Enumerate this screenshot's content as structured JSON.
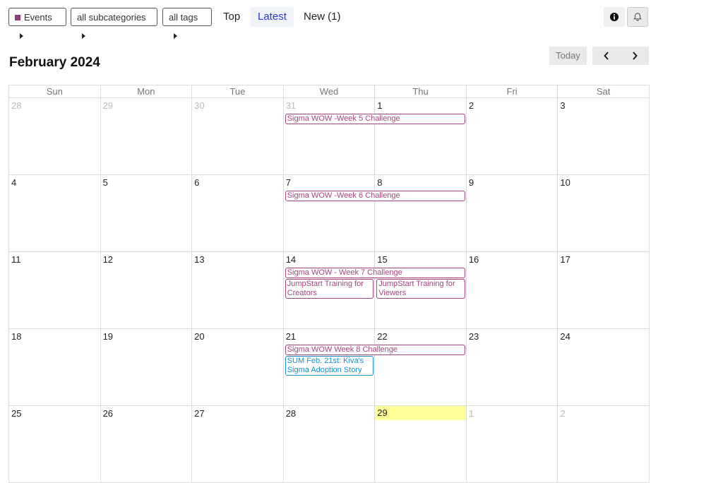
{
  "nav": {
    "category": "Events",
    "subcategories": "all subcategories",
    "tags": "all tags",
    "tabs": [
      {
        "label": "Top",
        "active": false
      },
      {
        "label": "Latest",
        "active": true
      },
      {
        "label": "New (1)",
        "active": false
      }
    ]
  },
  "calendar": {
    "month_title": "February 2024",
    "today_label": "Today",
    "weekdays": [
      "Sun",
      "Mon",
      "Tue",
      "Wed",
      "Thu",
      "Fri",
      "Sat"
    ],
    "weeks": [
      {
        "days": [
          {
            "n": "28",
            "other": true
          },
          {
            "n": "29",
            "other": true
          },
          {
            "n": "30",
            "other": true
          },
          {
            "n": "31",
            "other": true
          },
          {
            "n": "1"
          },
          {
            "n": "2"
          },
          {
            "n": "3"
          }
        ],
        "events": [
          {
            "title": "Sigma WOW -Week 5 Challenge",
            "start": 3,
            "span": 2,
            "row": 0,
            "color": "purple"
          }
        ]
      },
      {
        "days": [
          {
            "n": "4"
          },
          {
            "n": "5"
          },
          {
            "n": "6"
          },
          {
            "n": "7"
          },
          {
            "n": "8"
          },
          {
            "n": "9"
          },
          {
            "n": "10"
          }
        ],
        "events": [
          {
            "title": "Sigma WOW -Week 6 Challenge",
            "start": 3,
            "span": 2,
            "row": 0,
            "color": "purple"
          }
        ]
      },
      {
        "days": [
          {
            "n": "11"
          },
          {
            "n": "12"
          },
          {
            "n": "13"
          },
          {
            "n": "14"
          },
          {
            "n": "15"
          },
          {
            "n": "16"
          },
          {
            "n": "17"
          }
        ],
        "events": [
          {
            "title": "Sigma WOW - Week 7 Challenge",
            "start": 3,
            "span": 2,
            "row": 0,
            "color": "purple"
          },
          {
            "title": "JumpStart Training for Creators",
            "start": 3,
            "span": 1,
            "row": 1,
            "color": "purple"
          },
          {
            "title": "JumpStart Training for Viewers",
            "start": 4,
            "span": 1,
            "row": 1,
            "color": "purple"
          }
        ]
      },
      {
        "days": [
          {
            "n": "18"
          },
          {
            "n": "19"
          },
          {
            "n": "20"
          },
          {
            "n": "21"
          },
          {
            "n": "22"
          },
          {
            "n": "23"
          },
          {
            "n": "24"
          }
        ],
        "events": [
          {
            "title": "Sigma WOW Week 8 Challenge",
            "start": 3,
            "span": 2,
            "row": 0,
            "color": "purple"
          },
          {
            "title": "SUM Feb. 21st: Kiva's Sigma Adoption Story",
            "start": 3,
            "span": 1,
            "row": 1,
            "color": "blue"
          }
        ]
      },
      {
        "days": [
          {
            "n": "25"
          },
          {
            "n": "26"
          },
          {
            "n": "27"
          },
          {
            "n": "28"
          },
          {
            "n": "29",
            "today": true
          },
          {
            "n": "1",
            "other": true
          },
          {
            "n": "2",
            "other": true
          }
        ],
        "events": []
      }
    ]
  }
}
